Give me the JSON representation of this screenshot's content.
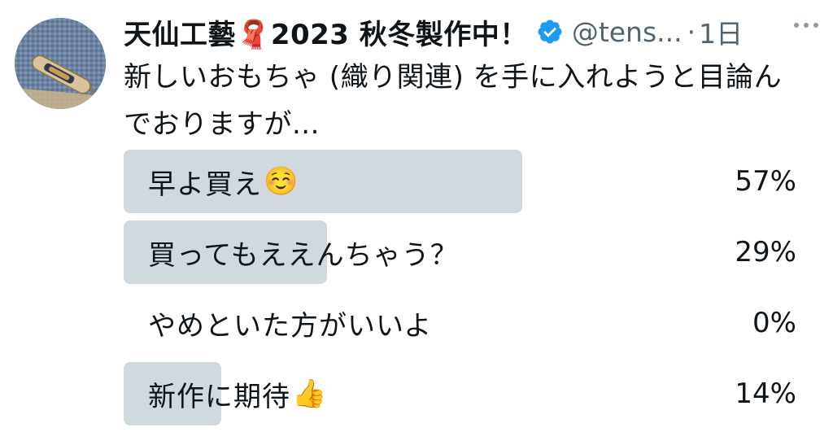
{
  "tweet": {
    "display_name": "天仙工藝🧣2023 秋冬製作中！",
    "handle": "@tens...",
    "separator": "·",
    "time": "1日",
    "text": "新しいおもちゃ (織り関連) を手に入れようと目論んでおりますが..."
  },
  "icons": {
    "verified": "verified-badge-icon",
    "more": "more-icon",
    "avatar": "loom-shuttle-avatar"
  },
  "colors": {
    "text": "#0f1419",
    "secondary": "#536471",
    "verified": "#1d9bf0",
    "poll_bar": "#cfd9de"
  },
  "poll": {
    "options": [
      {
        "label": "早よ買え",
        "emoji": "☺️",
        "percent": "57%",
        "value": 57
      },
      {
        "label": "買ってもええんちゃう？",
        "emoji": "",
        "percent": "29%",
        "value": 29
      },
      {
        "label": "やめといた方がいいよ",
        "emoji": "",
        "percent": "0%",
        "value": 0
      },
      {
        "label": "新作に期待",
        "emoji": "👍",
        "percent": "14%",
        "value": 14
      }
    ]
  }
}
